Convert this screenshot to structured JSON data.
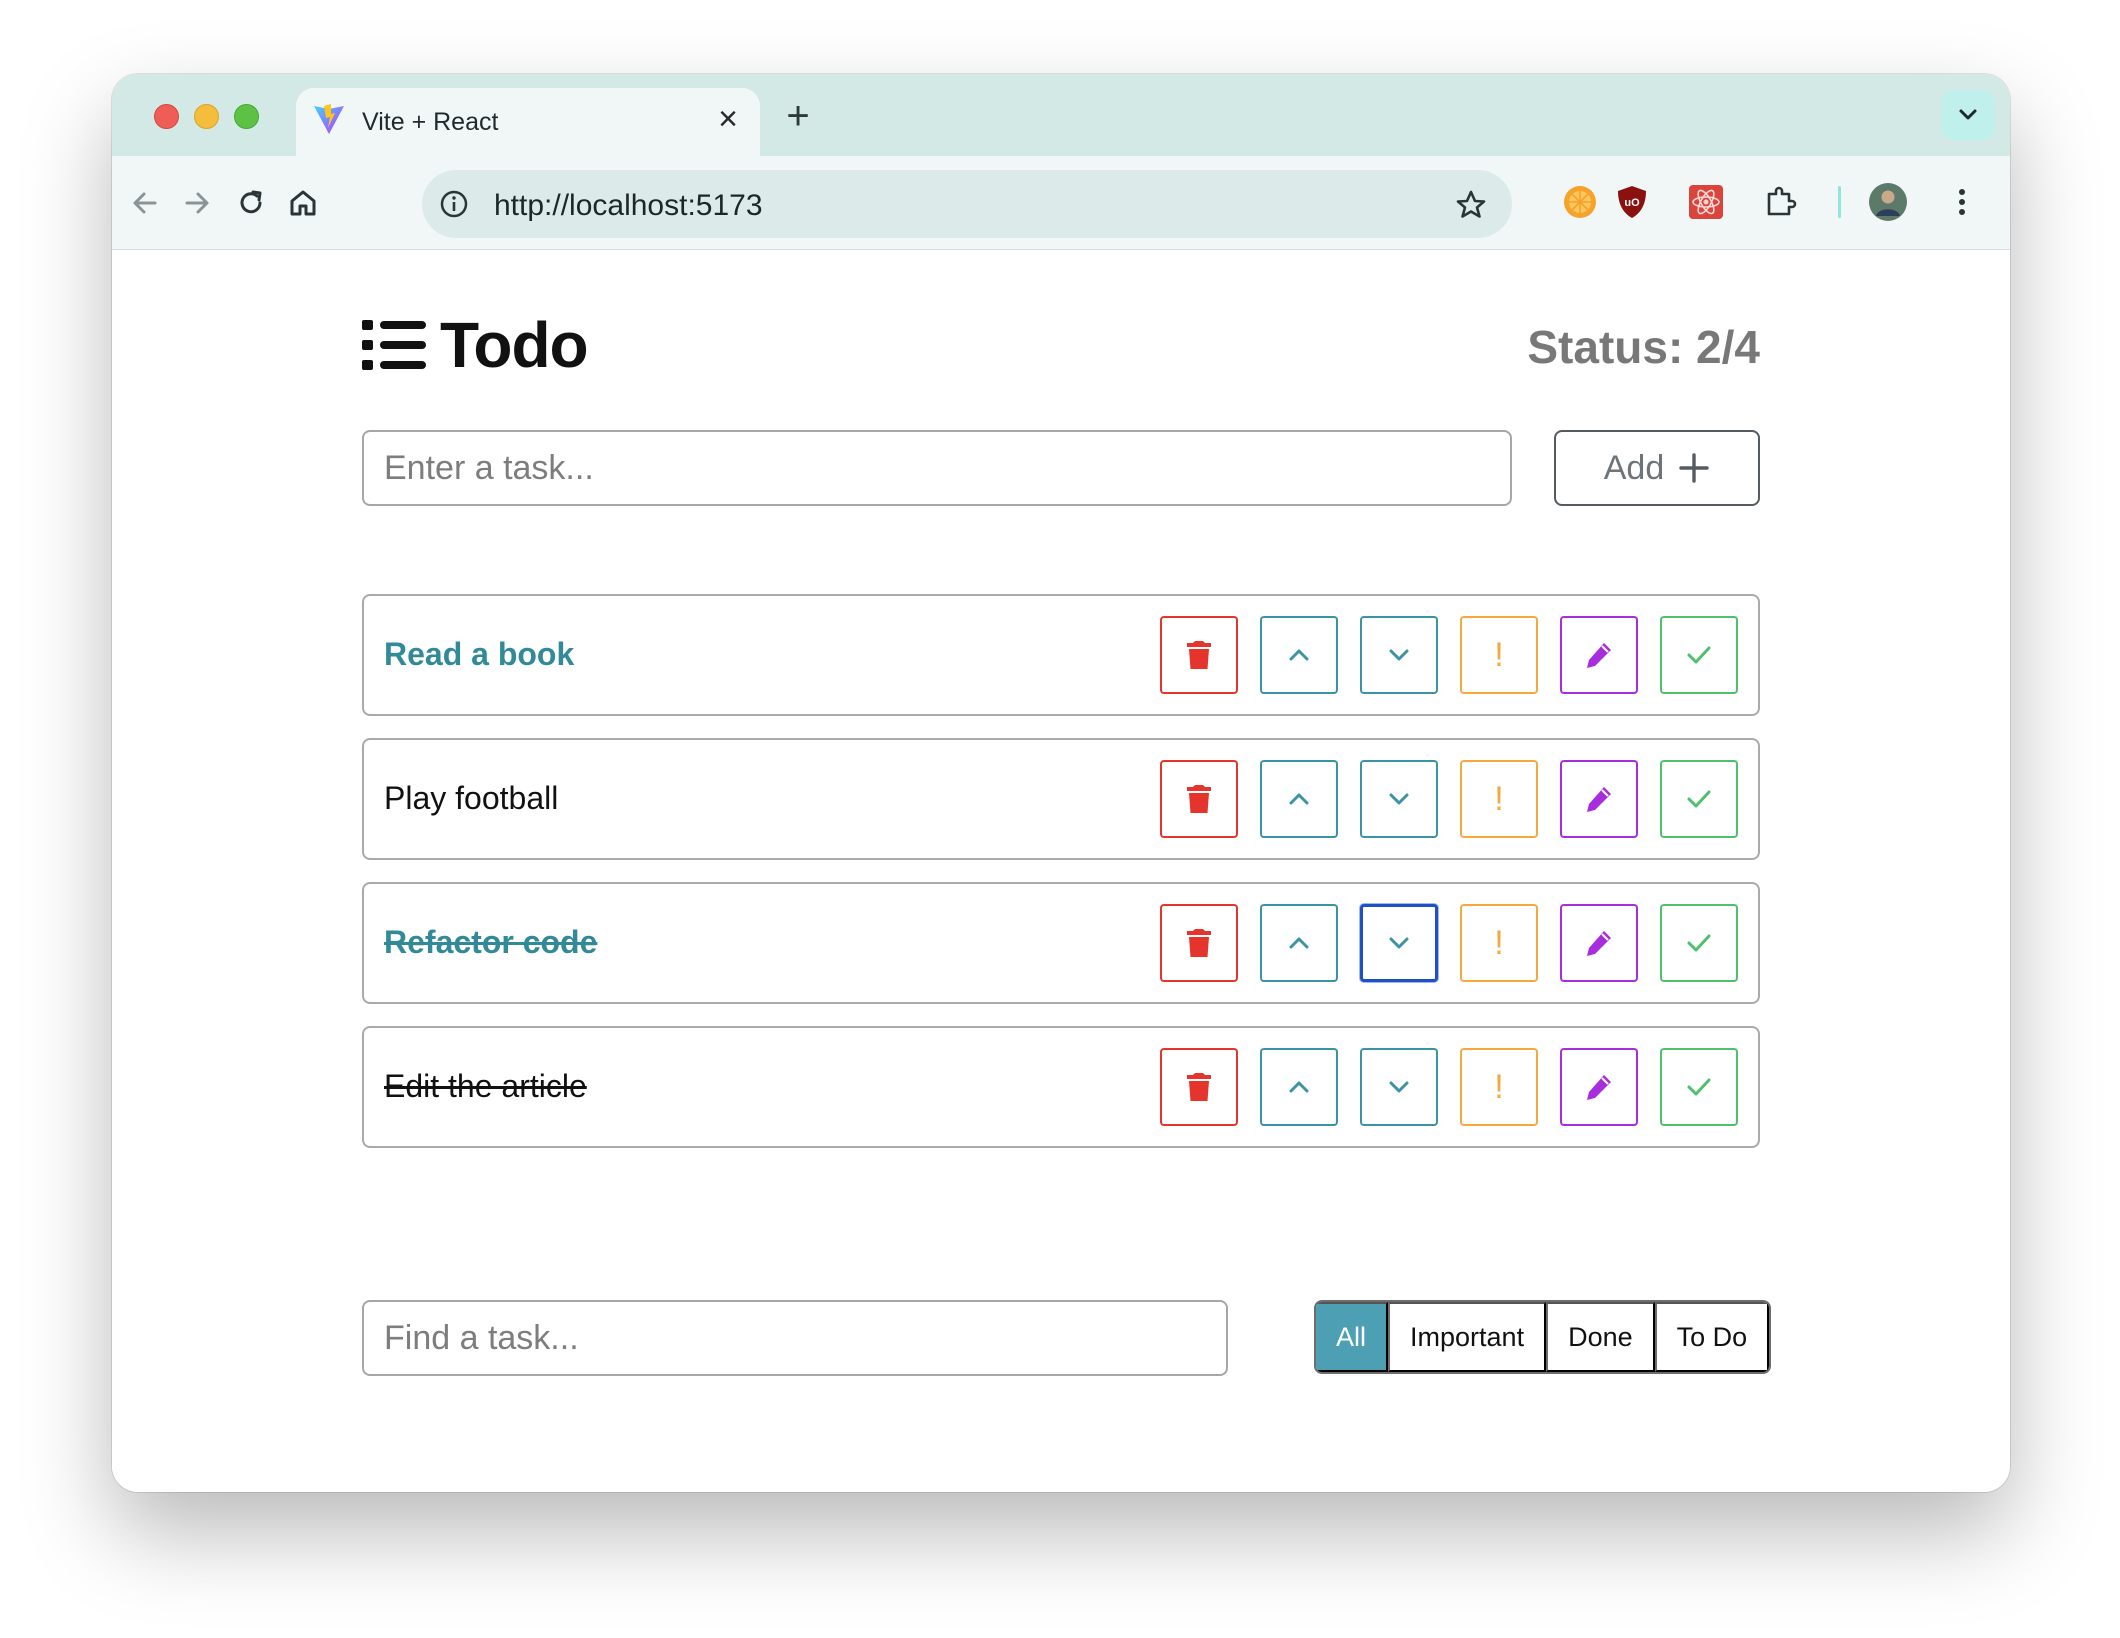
{
  "browser": {
    "tab_title": "Vite + React",
    "url": "http://localhost:5173"
  },
  "app": {
    "title": "Todo",
    "status": "Status: 2/4",
    "task_input_placeholder": "Enter a task...",
    "add_button_label": "Add",
    "find_input_placeholder": "Find a task...",
    "tasks": [
      {
        "name": "Read a book",
        "important": true,
        "done": false
      },
      {
        "name": "Play football",
        "important": false,
        "done": false
      },
      {
        "name": "Refactor code",
        "important": true,
        "done": true
      },
      {
        "name": "Edit the article",
        "important": false,
        "done": true
      }
    ],
    "filters": [
      {
        "label": "All",
        "active": true
      },
      {
        "label": "Important",
        "active": false
      },
      {
        "label": "Done",
        "active": false
      },
      {
        "label": "To Do",
        "active": false
      }
    ],
    "important_glyph": "!"
  },
  "colors": {
    "delete": "#e5342b",
    "move": "#3b93a4",
    "important": "#f4a93a",
    "edit": "#a82ddc",
    "done": "#4fc06b",
    "active_filter": "#4d9fb3",
    "important_text": "#328a98"
  },
  "icons": {
    "delete": "trash-icon",
    "up": "chevron-up-icon",
    "down": "chevron-down-icon",
    "important": "exclamation-icon",
    "edit": "pencil-icon",
    "done": "checkmark-icon",
    "add": "plus-icon",
    "title": "list-icon"
  }
}
